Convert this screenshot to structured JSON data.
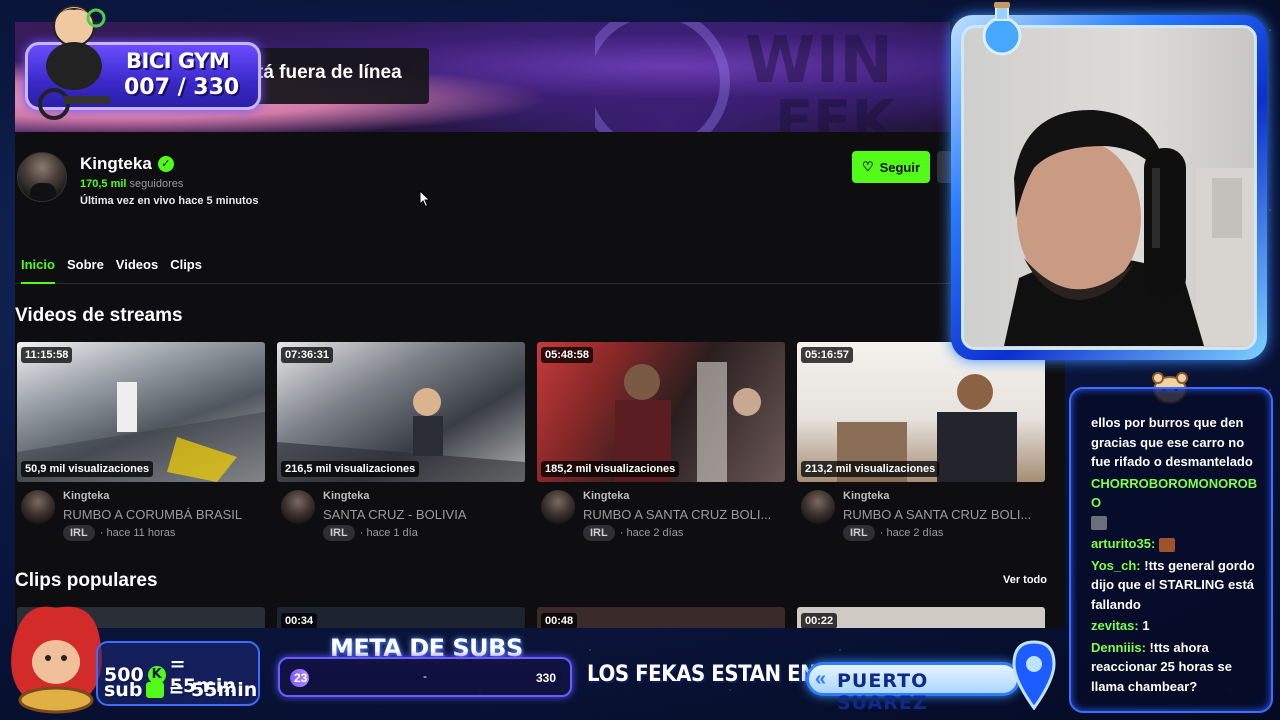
{
  "banner": {
    "offline_text": "tá fuera de línea"
  },
  "channel": {
    "name": "Kingteka",
    "followers_count": "170,5 mil",
    "followers_label": "seguidores",
    "last_live": "Última vez en vivo hace 5 minutos",
    "follow_label": "Seguir"
  },
  "tabs": [
    {
      "label": "Inicio",
      "active": true
    },
    {
      "label": "Sobre",
      "active": false
    },
    {
      "label": "Videos",
      "active": false
    },
    {
      "label": "Clips",
      "active": false
    }
  ],
  "sections": {
    "streams_title": "Videos de streams",
    "clips_title": "Clips populares",
    "see_all": "Ver todo"
  },
  "videos": [
    {
      "duration": "11:15:58",
      "views": "50,9 mil visualizaciones",
      "channel": "Kingteka",
      "title": "RUMBO A CORUMBÁ BRASIL",
      "tag": "IRL",
      "age": "· hace 11 horas"
    },
    {
      "duration": "07:36:31",
      "views": "216,5 mil visualizaciones",
      "channel": "Kingteka",
      "title": "SANTA CRUZ - BOLIVIA",
      "tag": "IRL",
      "age": "· hace 1 día"
    },
    {
      "duration": "05:48:58",
      "views": "185,2 mil visualizaciones",
      "channel": "Kingteka",
      "title": "RUMBO A SANTA CRUZ BOLI...",
      "tag": "IRL",
      "age": "· hace 2 días"
    },
    {
      "duration": "05:16:57",
      "views": "213,2 mil visualizaciones",
      "channel": "Kingteka",
      "title": "RUMBO A SANTA CRUZ BOLI...",
      "tag": "IRL",
      "age": "· hace 2 días"
    }
  ],
  "clips": [
    {
      "duration": ""
    },
    {
      "duration": "00:34"
    },
    {
      "duration": "00:48"
    },
    {
      "duration": "00:22"
    }
  ],
  "overlay": {
    "bici_title": "BICI GYM",
    "bici_count": "007 / 330",
    "subs_line1_value": "500",
    "subs_line1_result": "= 55min",
    "subs_line2_value": "sub",
    "subs_line2_result": "= 55min",
    "meta_title": "META DE SUBS",
    "meta_current": "23",
    "meta_separator": "-",
    "meta_goal": "330",
    "meta_fraction": 0.07,
    "fekas_label": "LOS FEKAS ESTAN EN:",
    "location": "PUERTO SUAREZ"
  },
  "chat": [
    {
      "user": "",
      "text": "ellos por burros que den gracias que ese carro no fue rifado o desmantelado"
    },
    {
      "user": "CHORROBOROMONOROBO",
      "text": ""
    },
    {
      "user": "arturito35:",
      "text": ""
    },
    {
      "user": "Yos_ch:",
      "text": "!tts general gordo dijo que el STARLING está fallando"
    },
    {
      "user": "zevitas:",
      "text": "1"
    },
    {
      "user": "Denniiis:",
      "text": "!tts ahora reaccionar 25 horas se llama chambear?"
    }
  ],
  "colors": {
    "brand_green": "#53fc18",
    "overlay_blue": "#2f7dff",
    "overlay_purple": "#6b4cff"
  }
}
